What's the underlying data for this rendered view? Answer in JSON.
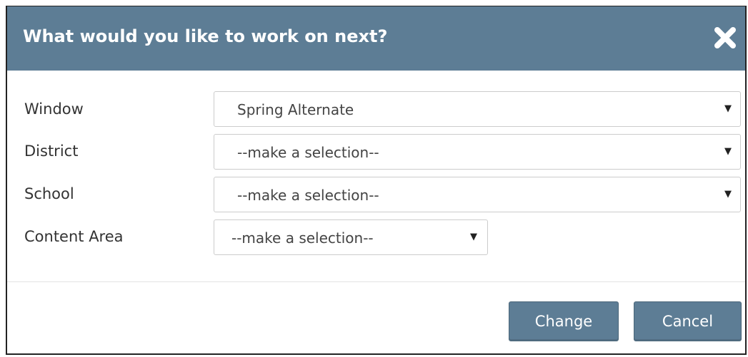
{
  "dialog": {
    "title": "What would you like to work on next?",
    "close_icon": "close-x-icon",
    "header_color": "#5d7d95"
  },
  "fields": [
    {
      "label": "Window",
      "value": "Spring Alternate"
    },
    {
      "label": "District",
      "value": "--make a selection--"
    },
    {
      "label": "School",
      "value": "--make a selection--"
    },
    {
      "label": "Content Area",
      "value": "--make a selection--"
    }
  ],
  "buttons": {
    "change_label": "Change",
    "cancel_label": "Cancel"
  }
}
